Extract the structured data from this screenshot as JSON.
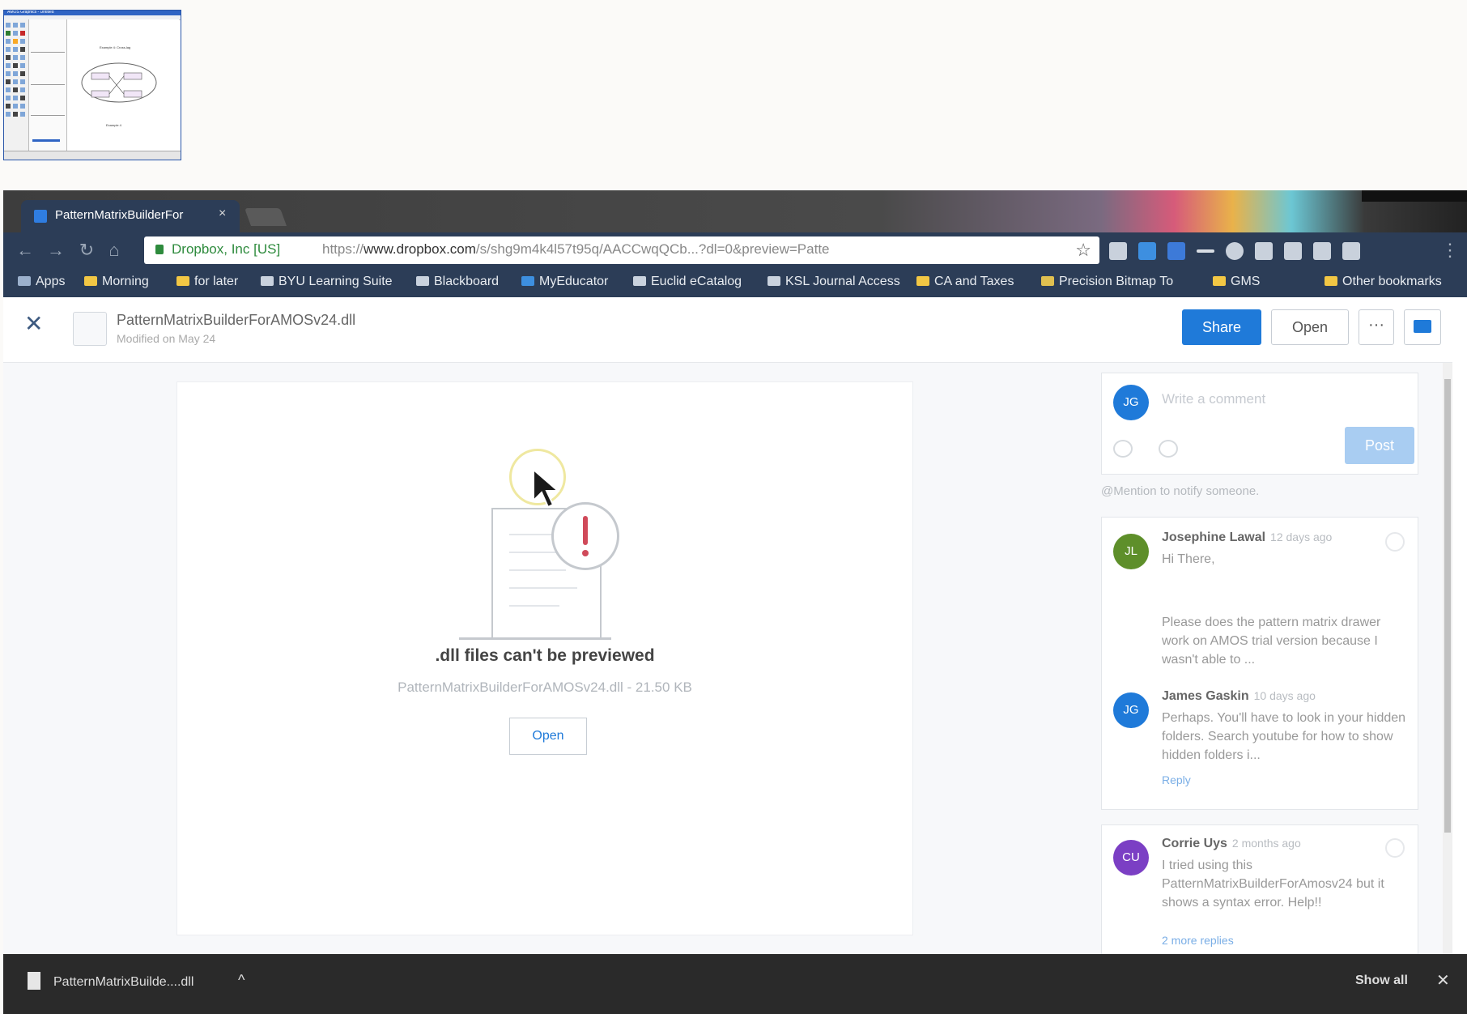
{
  "thumbnail": {
    "title": "AMOS Graphics - Untitled",
    "diagram_title": "Example 4: Cross-lag",
    "diagram_caption": "Example 4"
  },
  "browser": {
    "tab_title": "PatternMatrixBuilderFor",
    "tab_close": "×",
    "site_identity": "Dropbox, Inc [US]",
    "url_prefix": "https://",
    "url_host": "www.dropbox.com",
    "url_path": "/s/shg9m4k4l57t95q/AACCwqQCb...?dl=0&preview=Patte",
    "bookmarks": [
      {
        "label": "Apps"
      },
      {
        "label": "Morning"
      },
      {
        "label": "for later"
      },
      {
        "label": "BYU Learning Suite"
      },
      {
        "label": "Blackboard"
      },
      {
        "label": "MyEducator"
      },
      {
        "label": "Euclid eCatalog"
      },
      {
        "label": "KSL Journal Access"
      },
      {
        "label": "CA and Taxes"
      },
      {
        "label": "Precision Bitmap To"
      },
      {
        "label": "GMS"
      },
      {
        "label": "Other bookmarks"
      }
    ]
  },
  "header": {
    "close_label": "✕",
    "file_name": "PatternMatrixBuilderForAMOSv24.dll",
    "modified": "Modified on May 24",
    "share_label": "Share",
    "open_label": "Open",
    "more_label": "···"
  },
  "preview": {
    "title": ".dll files can't be previewed",
    "subtitle": "PatternMatrixBuilderForAMOSv24.dll - 21.50 KB",
    "open_label": "Open"
  },
  "comments": {
    "compose_avatar": "JG",
    "compose_placeholder": "Write a comment",
    "post_label": "Post",
    "mention_hint": "@Mention to notify someone.",
    "thread1": {
      "author": "Josephine Lawal",
      "time": "12 days ago",
      "avatar": "JL",
      "avatar_color": "#5e8f2a",
      "text1": "Hi There,",
      "text2": "Please does the pattern matrix drawer work on AMOS trial version because I wasn't able to ...",
      "reply_author": "James Gaskin",
      "reply_time": "10 days ago",
      "reply_avatar": "JG",
      "reply_text": "Perhaps. You'll have to look in your hidden folders. Search youtube for how to show hidden folders i...",
      "reply_link": "Reply"
    },
    "thread2": {
      "author": "Corrie Uys",
      "time": "2 months ago",
      "avatar": "CU",
      "avatar_color": "#7b3fc4",
      "text": "I tried using this PatternMatrixBuilderForAmosv24 but it shows a syntax error.  Help!!",
      "more_link": "2 more replies"
    }
  },
  "download_bar": {
    "file": "PatternMatrixBuilde....dll",
    "show_all": "Show all",
    "close": "✕"
  },
  "colors": {
    "accent": "#1f7ad9",
    "chrome": "#2c3d57",
    "error": "#d04a5a"
  }
}
